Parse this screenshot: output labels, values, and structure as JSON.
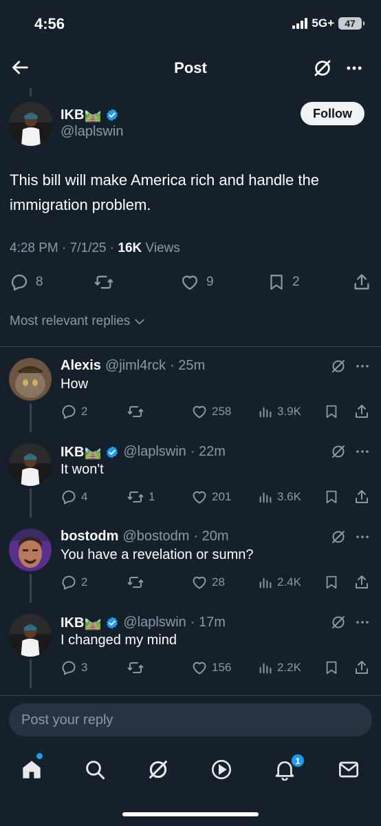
{
  "status_bar": {
    "time": "4:56",
    "network": "5G+",
    "battery": "47"
  },
  "header": {
    "title": "Post"
  },
  "post": {
    "author": {
      "display_name": "IKB🛤️",
      "handle": "@laplswin",
      "verified": true
    },
    "follow_label": "Follow",
    "text": "This bill will make America rich and handle the immigration problem.",
    "meta": {
      "time": "4:28 PM",
      "date": "7/1/25",
      "views_count": "16K",
      "views_label": "Views"
    },
    "actions": {
      "replies": "8",
      "reposts": "",
      "likes": "9",
      "bookmarks": "2"
    }
  },
  "replies_sort_label": "Most relevant replies",
  "replies": [
    {
      "display_name": "Alexis",
      "handle": "@jiml4rck",
      "time": "· 25m",
      "verified": false,
      "text": "How",
      "replies": "2",
      "reposts": "",
      "likes": "258",
      "views": "3.9K"
    },
    {
      "display_name": "IKB🛤️",
      "handle": "@laplswin",
      "time": "· 22m",
      "verified": true,
      "text": "It won't",
      "replies": "4",
      "reposts": "1",
      "likes": "201",
      "views": "3.6K"
    },
    {
      "display_name": "bostodm",
      "handle": "@bostodm",
      "time": "· 20m",
      "verified": false,
      "text": "You have a revelation or sumn?",
      "replies": "2",
      "reposts": "",
      "likes": "28",
      "views": "2.4K"
    },
    {
      "display_name": "IKB🛤️",
      "handle": "@laplswin",
      "time": "· 17m",
      "verified": true,
      "text": "I changed my mind",
      "replies": "3",
      "reposts": "",
      "likes": "156",
      "views": "2.2K"
    }
  ],
  "composer": {
    "placeholder": "Post your reply"
  },
  "tab_bar": {
    "items": [
      "home-icon",
      "search-icon",
      "grok-icon",
      "video-icon",
      "notifications-icon",
      "messages-icon"
    ],
    "notifications_badge": "1"
  },
  "colors": {
    "background": "#15202b",
    "accent": "#1d9bf0",
    "muted": "#8b98a5"
  }
}
